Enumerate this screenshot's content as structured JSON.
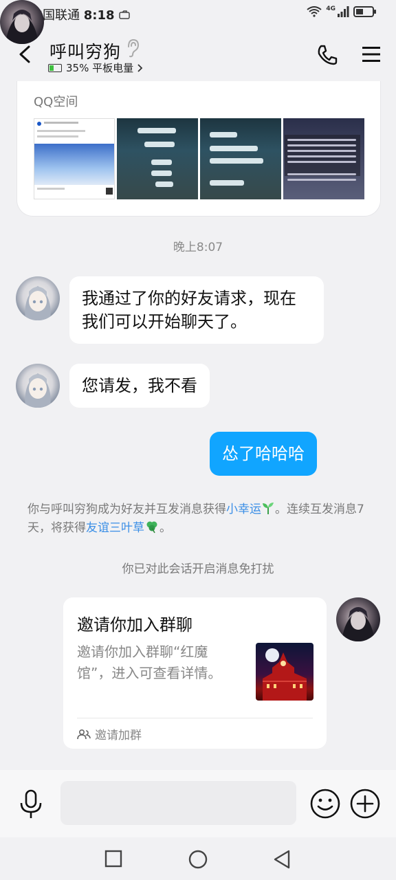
{
  "status_bar": {
    "carrier": "中国联通",
    "time": "8:18",
    "network": "4G"
  },
  "header": {
    "title": "呼叫穷狗",
    "battery_text": "35% 平板电量",
    "icons": [
      "back-icon",
      "ear-icon",
      "phone-icon",
      "menu-icon"
    ]
  },
  "qzone": {
    "title": "QQ空间"
  },
  "messages": {
    "timestamp": "晚上8:07",
    "m1": "我通过了你的好友请求，现在我们可以开始聊天了。",
    "m2": "您请发，我不看",
    "m3": "怂了哈哈哈"
  },
  "system": {
    "friend_part1": "你与呼叫穷狗成为好友并互发消息获得",
    "lucky": "小幸运",
    "friend_part2": "。连续互发消息7天，将获得",
    "clover": "友谊三叶草",
    "friend_part3": "。",
    "dnd": "你已对此会话开启消息免打扰"
  },
  "invite": {
    "title": "邀请你加入群聊",
    "desc": "邀请你加入群聊“红魔馆”，进入可查看详情。",
    "footer": "邀请加群"
  },
  "colors": {
    "accent_blue": "#11a5ff",
    "link_blue": "#3a8ee6",
    "background": "#f1f1f3"
  }
}
